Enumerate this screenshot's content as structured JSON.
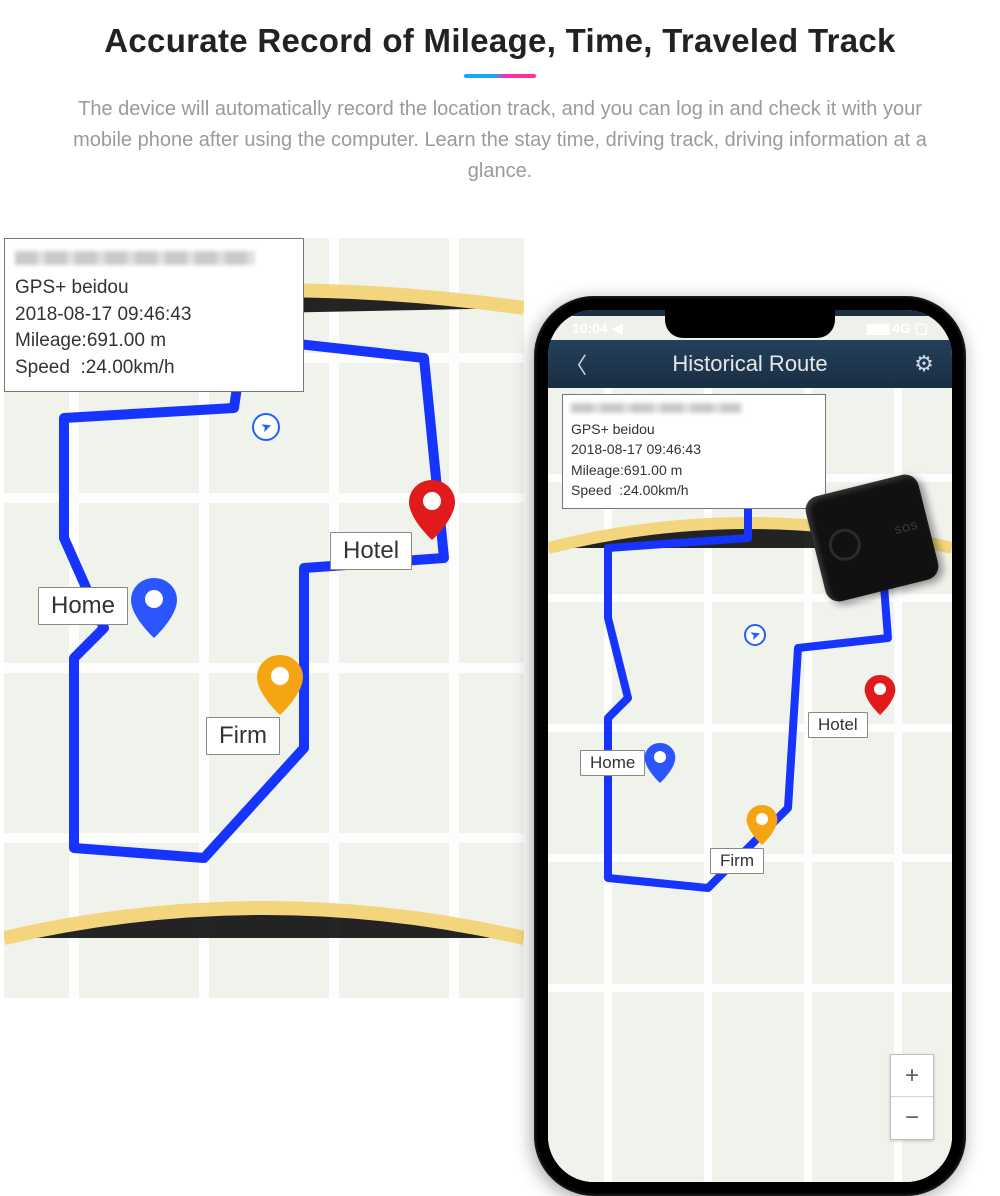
{
  "hero": {
    "title": "Accurate Record of Mileage, Time, Traveled Track",
    "subtitle": "The device will automatically record the location track, and you can log in and check it with your mobile phone after using the computer. Learn the stay time, driving track, driving information at a glance."
  },
  "track_info": {
    "mode": "GPS+ beidou",
    "timestamp": "2018-08-17 09:46:43",
    "mileage_label": "Mileage",
    "mileage_value": "691.00 m",
    "speed_label": "Speed",
    "speed_value": "24.00km/h"
  },
  "pois": {
    "home": "Home",
    "hotel": "Hotel",
    "firm": "Firm"
  },
  "phone": {
    "status_time": "10:04 ◀",
    "status_net": "4G",
    "nav_title": "Historical Route",
    "zoom_in": "+",
    "zoom_out": "−"
  },
  "pin_colors": {
    "home": "#2b55ff",
    "hotel": "#e11b1b",
    "firm": "#f5a412"
  }
}
